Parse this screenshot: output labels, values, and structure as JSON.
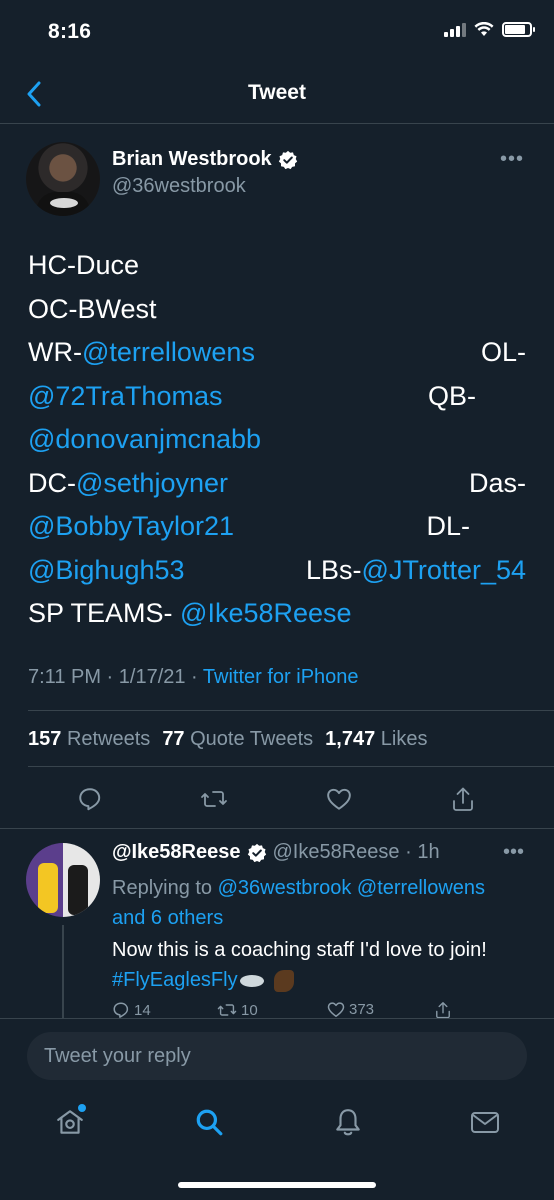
{
  "status_bar": {
    "time": "8:16"
  },
  "nav": {
    "title": "Tweet"
  },
  "tweet": {
    "author_name": "Brian Westbrook",
    "author_handle": "@36westbrook",
    "lines": [
      {
        "left": "HC-Duce",
        "right": ""
      },
      {
        "left": "OC-BWest",
        "right": ""
      },
      {
        "left_prefix": "WR-",
        "left_mention": "@terrellowens",
        "right": "OL-"
      },
      {
        "left_mention": "@72TraThomas",
        "right": "QB-"
      },
      {
        "left_mention": "@donovanjmcnabb",
        "right": ""
      },
      {
        "left_prefix": "DC-",
        "left_mention": "@sethjoyner",
        "right": "Das-"
      },
      {
        "left_mention": "@BobbyTaylor21",
        "right": "DL-"
      },
      {
        "left_mention": "@Bighugh53",
        "mid_prefix": "LBs-",
        "mid_mention": "@JTrotter_54"
      },
      {
        "left_prefix": "SP TEAMS- ",
        "left_mention": "@Ike58Reese"
      }
    ],
    "timestamp": "7:11 PM · 1/17/21 · ",
    "source": "Twitter for iPhone",
    "stats": {
      "retweets_count": "157",
      "retweets_label": "Retweets",
      "quotes_count": "77",
      "quotes_label": "Quote Tweets",
      "likes_count": "1,747",
      "likes_label": "Likes"
    }
  },
  "reply": {
    "name": "@Ike58Reese",
    "handle_time": "@Ike58Reese · 1h",
    "replying_prefix": "Replying to ",
    "replying_mention_1": "@36westbrook",
    "replying_mention_2": "@terrellowens",
    "replying_others": "and 6 others",
    "text": "Now this is a coaching staff I'd love to join!",
    "hashtag": "#FlyEaglesFly",
    "reply_count": "14",
    "retweet_count": "10",
    "like_count": "373"
  },
  "compose": {
    "placeholder": "Tweet your reply"
  },
  "colors": {
    "background": "#15202b",
    "accent": "#1da1f2",
    "secondary_text": "#8899a6",
    "divider": "#38444d"
  },
  "icons": [
    "back-chevron-icon",
    "verified-badge-icon",
    "more-icon",
    "reply-icon",
    "retweet-icon",
    "like-icon",
    "share-icon",
    "home-icon",
    "search-icon",
    "notifications-icon",
    "messages-icon"
  ]
}
